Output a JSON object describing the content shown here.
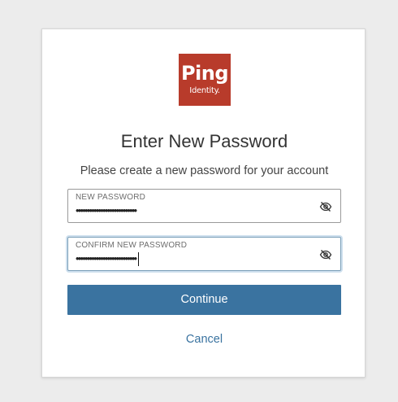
{
  "logo": {
    "brand": "Ping",
    "sub": "Identity."
  },
  "heading": {
    "title": "Enter New Password",
    "subtitle": "Please create a new password for your account"
  },
  "fields": {
    "new_password": {
      "label": "NEW PASSWORD",
      "value": "•••••••••••••••••••••••••••",
      "icon": "eye-slash-icon"
    },
    "confirm_password": {
      "label": "CONFIRM NEW PASSWORD",
      "value": "•••••••••••••••••••••••••••",
      "icon": "eye-slash-icon",
      "focused": true
    }
  },
  "actions": {
    "continue_label": "Continue",
    "cancel_label": "Cancel"
  },
  "colors": {
    "brand": "#b83b2b",
    "primary": "#3a73a0",
    "background": "#ececec"
  }
}
